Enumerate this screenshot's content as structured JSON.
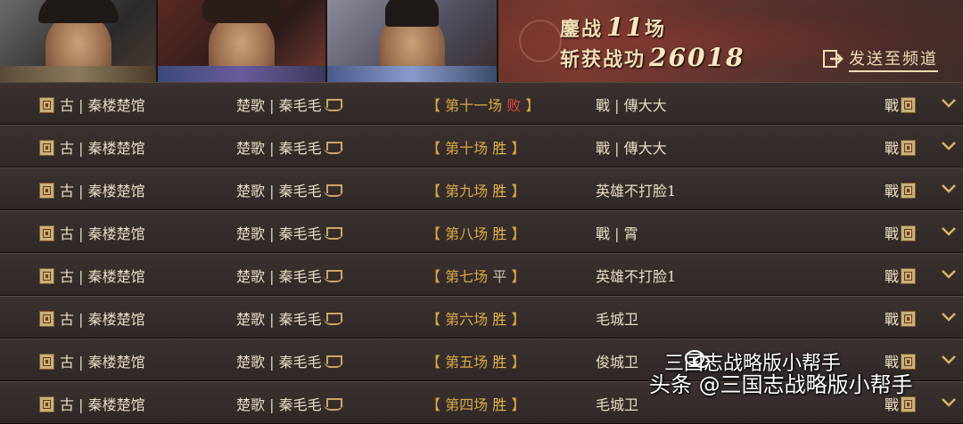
{
  "header": {
    "stat_battles_label": "鏖战",
    "stat_battles_value": "11",
    "stat_battles_unit": "场",
    "stat_merit_label": "斩获战功",
    "stat_merit_value": "26018",
    "send_label": "发送至频道",
    "send_icon": "export-icon",
    "portraits": [
      "general-portrait-1",
      "general-portrait-2",
      "general-portrait-3"
    ]
  },
  "rows": [
    {
      "left": "古 | 秦楼楚馆",
      "mid": "楚歌 | 秦毛毛",
      "match_open": "【",
      "match_label": "第十一场",
      "result": "败",
      "result_type": "lose",
      "match_close": "】",
      "opponent": "戰 | 傳大大",
      "right": "戰"
    },
    {
      "left": "古 | 秦楼楚馆",
      "mid": "楚歌 | 秦毛毛",
      "match_open": "【",
      "match_label": "第十场",
      "result": "胜",
      "result_type": "win",
      "match_close": "】",
      "opponent": "戰 | 傳大大",
      "right": "戰"
    },
    {
      "left": "古 | 秦楼楚馆",
      "mid": "楚歌 | 秦毛毛",
      "match_open": "【",
      "match_label": "第九场",
      "result": "胜",
      "result_type": "win",
      "match_close": "】",
      "opponent": "英雄不打脸1",
      "right": "戰"
    },
    {
      "left": "古 | 秦楼楚馆",
      "mid": "楚歌 | 秦毛毛",
      "match_open": "【",
      "match_label": "第八场",
      "result": "胜",
      "result_type": "win",
      "match_close": "】",
      "opponent": "戰 | 霄",
      "right": "戰"
    },
    {
      "left": "古 | 秦楼楚馆",
      "mid": "楚歌 | 秦毛毛",
      "match_open": "【",
      "match_label": "第七场",
      "result": "平",
      "result_type": "draw",
      "match_close": "】",
      "opponent": "英雄不打脸1",
      "right": "戰"
    },
    {
      "left": "古 | 秦楼楚馆",
      "mid": "楚歌 | 秦毛毛",
      "match_open": "【",
      "match_label": "第六场",
      "result": "胜",
      "result_type": "win",
      "match_close": "】",
      "opponent": "毛城卫",
      "right": "戰"
    },
    {
      "left": "古 | 秦楼楚馆",
      "mid": "楚歌 | 秦毛毛",
      "match_open": "【",
      "match_label": "第五场",
      "result": "胜",
      "result_type": "win",
      "match_close": "】",
      "opponent": "俊城卫",
      "right": "戰"
    },
    {
      "left": "古 | 秦楼楚馆",
      "mid": "楚歌 | 秦毛毛",
      "match_open": "【",
      "match_label": "第四场",
      "result": "胜",
      "result_type": "win",
      "match_close": "】",
      "opponent": "毛城卫",
      "right": "戰"
    }
  ],
  "watermark": {
    "line1": "三国志战略版小帮手",
    "line2": "头条 @三国志战略版小帮手"
  },
  "colors": {
    "win": "#e7b54a",
    "lose": "#e0473a",
    "draw": "#c7bfb3",
    "text": "#e9dcc4",
    "accent": "#d9a846"
  }
}
